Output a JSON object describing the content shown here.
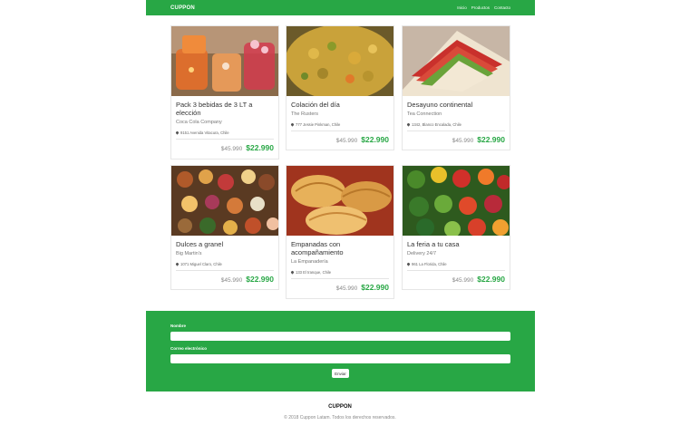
{
  "navbar": {
    "brand": "CUPPON",
    "links": [
      "Inicio",
      "Productos",
      "Contacto"
    ]
  },
  "products": [
    {
      "title": "Pack 3 bebidas de 3 LT a elección",
      "company": "Coca Cola Company",
      "address": "9151 Avenida Vitacura, Chile",
      "old_price": "$45.990",
      "price": "$22.990",
      "image": "soft drinks in glasses"
    },
    {
      "title": "Colación del día",
      "company": "The Rusters",
      "address": "777 Jessie Pinkman, Chile",
      "old_price": "$45.990",
      "price": "$22.990",
      "image": "curry dish"
    },
    {
      "title": "Desayuno continental",
      "company": "Tea Connection",
      "address": "1342, Blanco Encalada, Chile",
      "old_price": "$45.990",
      "price": "$22.990",
      "image": "sandwich"
    },
    {
      "title": "Dulces a granel",
      "company": "Big Martin's",
      "address": "1071 Miguel Claro, Chile",
      "old_price": "$45.990",
      "price": "$22.990",
      "image": "assorted sweets"
    },
    {
      "title": "Empanadas con acompañamiento",
      "company": "La Empanadería",
      "address": "133 El tranque, Chile",
      "old_price": "$45.990",
      "price": "$22.990",
      "image": "empanadas"
    },
    {
      "title": "La feria a tu casa",
      "company": "Delivery 24/7",
      "address": "961 La Florida, Chile",
      "old_price": "$45.990",
      "price": "$22.990",
      "image": "fresh vegetables"
    }
  ],
  "form": {
    "name_label": "Nombre",
    "email_label": "Correo electrónico",
    "submit_label": "Enviar"
  },
  "footer": {
    "brand": "CUPPON",
    "copyright": "© 2018 Cuppon Latam. Todos los derechos reservados."
  }
}
